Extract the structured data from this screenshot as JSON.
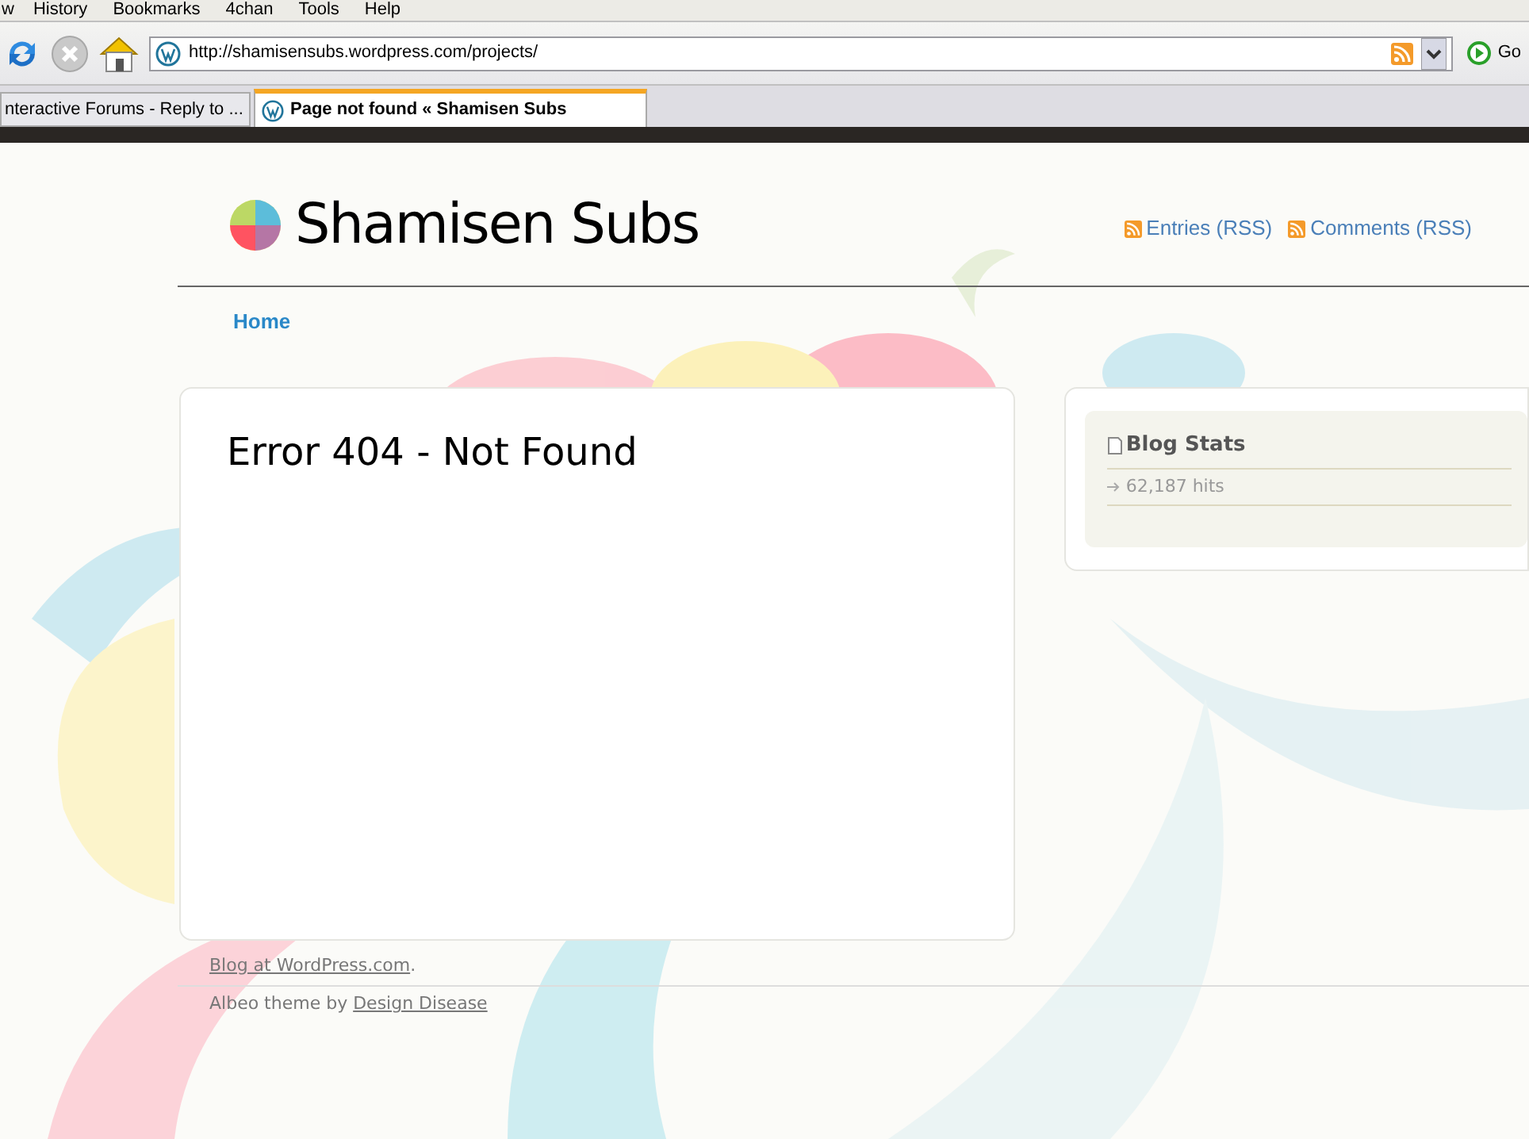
{
  "menu": [
    "w",
    "History",
    "Bookmarks",
    "4chan",
    "Tools",
    "Help"
  ],
  "toolbar": {
    "url": "http://shamisensubs.wordpress.com/projects/",
    "go_label": "Go"
  },
  "tabs": [
    {
      "label": "nteractive Forums - Reply to ...",
      "selected": false
    },
    {
      "label": "Page not found « Shamisen Subs",
      "selected": true
    }
  ],
  "site": {
    "title": "Shamisen Subs",
    "feeds": [
      "Entries (RSS)",
      "Comments (RSS)"
    ],
    "nav": [
      "Home"
    ]
  },
  "content": {
    "heading": "Error 404 - Not Found"
  },
  "sidebar": {
    "title": "Blog Stats",
    "items": [
      "62,187 hits"
    ]
  },
  "footer": {
    "blog_link": "Blog at WordPress.com",
    "blog_suffix": ".",
    "theme_prefix": "Albeo theme by",
    "theme_link": "Design Disease"
  }
}
